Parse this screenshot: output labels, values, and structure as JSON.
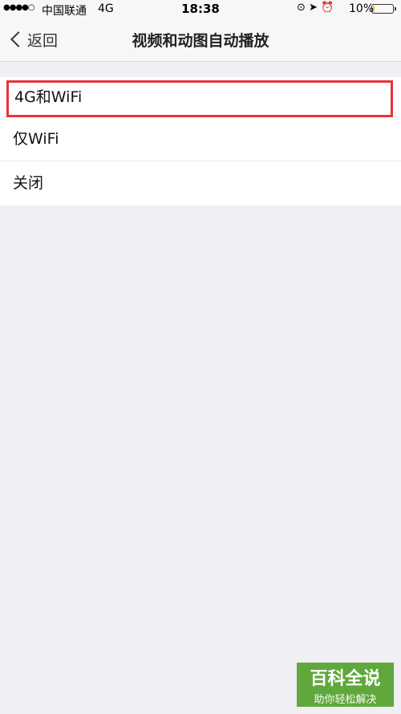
{
  "status_bar": {
    "signal": "●●●●○",
    "carrier": "中国联通",
    "network": "4G",
    "time": "18:38",
    "icons": "⊙ ➤ ⏰",
    "battery_percent": "10%",
    "battery_level": 0.1
  },
  "nav": {
    "back_label": "返回",
    "title": "视频和动图自动播放"
  },
  "options": [
    {
      "label": "4G和WiFi",
      "selected_highlight": true
    },
    {
      "label": "仅WiFi"
    },
    {
      "label": "关闭"
    }
  ],
  "watermark": {
    "title": "百科全说",
    "subtitle": "助你轻松解决"
  },
  "colors": {
    "highlight": "#e8333a",
    "background": "#efeff4",
    "watermark": "#50a028"
  }
}
